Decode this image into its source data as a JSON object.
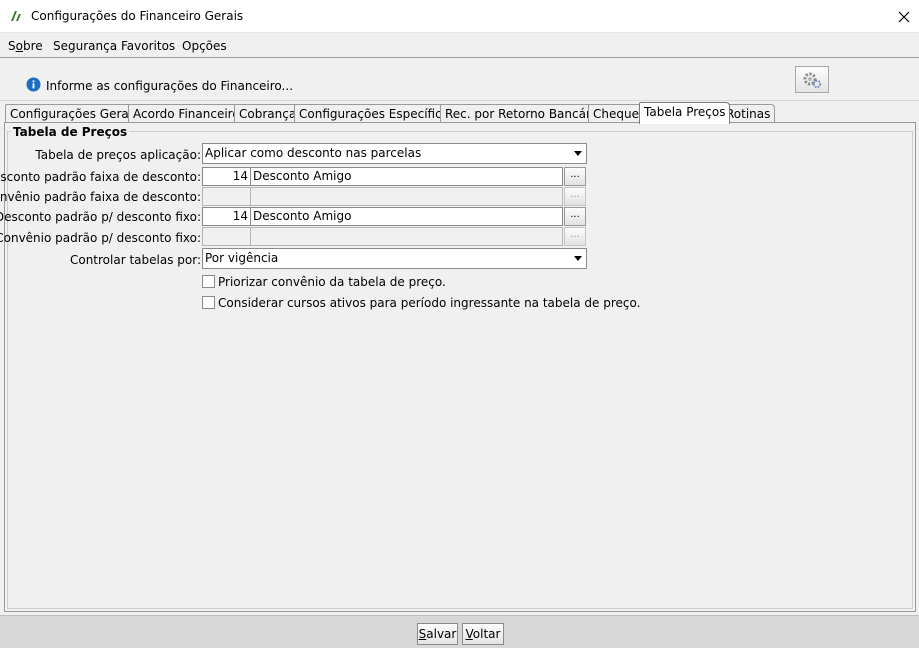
{
  "window": {
    "title": "Configurações do Financeiro Gerais"
  },
  "menu": {
    "items": [
      {
        "pre": "S",
        "ul": "o",
        "post": "bre"
      },
      {
        "pre": "Segurança",
        "ul": "",
        "post": ""
      },
      {
        "pre": "Favoritos",
        "ul": "",
        "post": ""
      },
      {
        "pre": "Opções",
        "ul": "",
        "post": ""
      }
    ]
  },
  "info": {
    "text": "Informe as configurações do Financeiro..."
  },
  "tabs": [
    "Configurações Gerais",
    "Acordo Financeiro",
    "Cobrança",
    "Configurações Específicas",
    "Rec. por Retorno Bancário",
    "Cheque",
    "Tabela Preços",
    "Rotinas"
  ],
  "active_tab": "Tabela Preços",
  "group": {
    "title": "Tabela de Preços",
    "fields": {
      "tabela_precos_label": "Tabela de preços aplicação:",
      "tabela_precos_value": "Aplicar como desconto nas parcelas",
      "desc_faixa_label": "Desconto padrão faixa de desconto:",
      "desc_faixa_code": "14",
      "desc_faixa_desc": "Desconto Amigo",
      "conv_faixa_label": "Convênio padrão faixa de desconto:",
      "conv_faixa_code": "",
      "conv_faixa_desc": "",
      "desc_fixo_label": "Desconto padrão p/ desconto fixo:",
      "desc_fixo_code": "14",
      "desc_fixo_desc": "Desconto Amigo",
      "conv_fixo_label": "Convênio padrão p/ desconto fixo:",
      "conv_fixo_code": "",
      "conv_fixo_desc": "",
      "controlar_label": "Controlar tabelas por:",
      "controlar_value": "Por vigência",
      "lookup_label": "...",
      "priorizar_label": "Priorizar convênio da tabela de preço.",
      "considerar_label": "Considerar cursos ativos para período ingressante na tabela de preço."
    }
  },
  "footer": {
    "save": {
      "ul": "S",
      "rest": "alvar"
    },
    "back": {
      "ul": "V",
      "rest": "oltar"
    }
  },
  "colors": {
    "accent": "#1b6ec2",
    "tab_active_bg": "#ffffff"
  }
}
